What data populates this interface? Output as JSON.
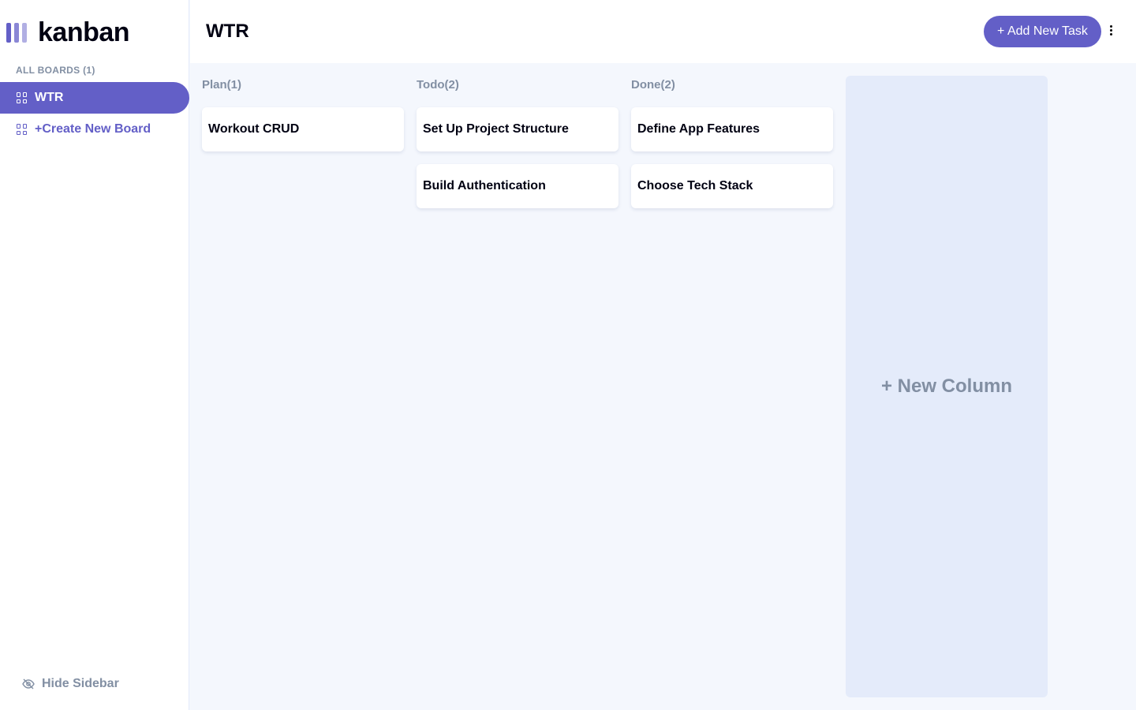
{
  "app": {
    "logo": "kanban",
    "accent": "#635fc7"
  },
  "sidebar": {
    "all_boards": "ALL BOARDS (1)",
    "boards": [
      {
        "label": "WTR",
        "active": true
      }
    ],
    "create": "+Create New Board",
    "hide": "Hide Sidebar"
  },
  "header": {
    "title": "WTR",
    "add_task": "+ Add New Task"
  },
  "columns": [
    {
      "title": "Plan(1)",
      "tasks": [
        "Workout CRUD"
      ]
    },
    {
      "title": "Todo(2)",
      "tasks": [
        "Set Up Project Structure",
        "Build Authentication"
      ]
    },
    {
      "title": "Done(2)",
      "tasks": [
        "Define App Features",
        "Choose Tech Stack"
      ]
    }
  ],
  "new_column": "+ New Column"
}
